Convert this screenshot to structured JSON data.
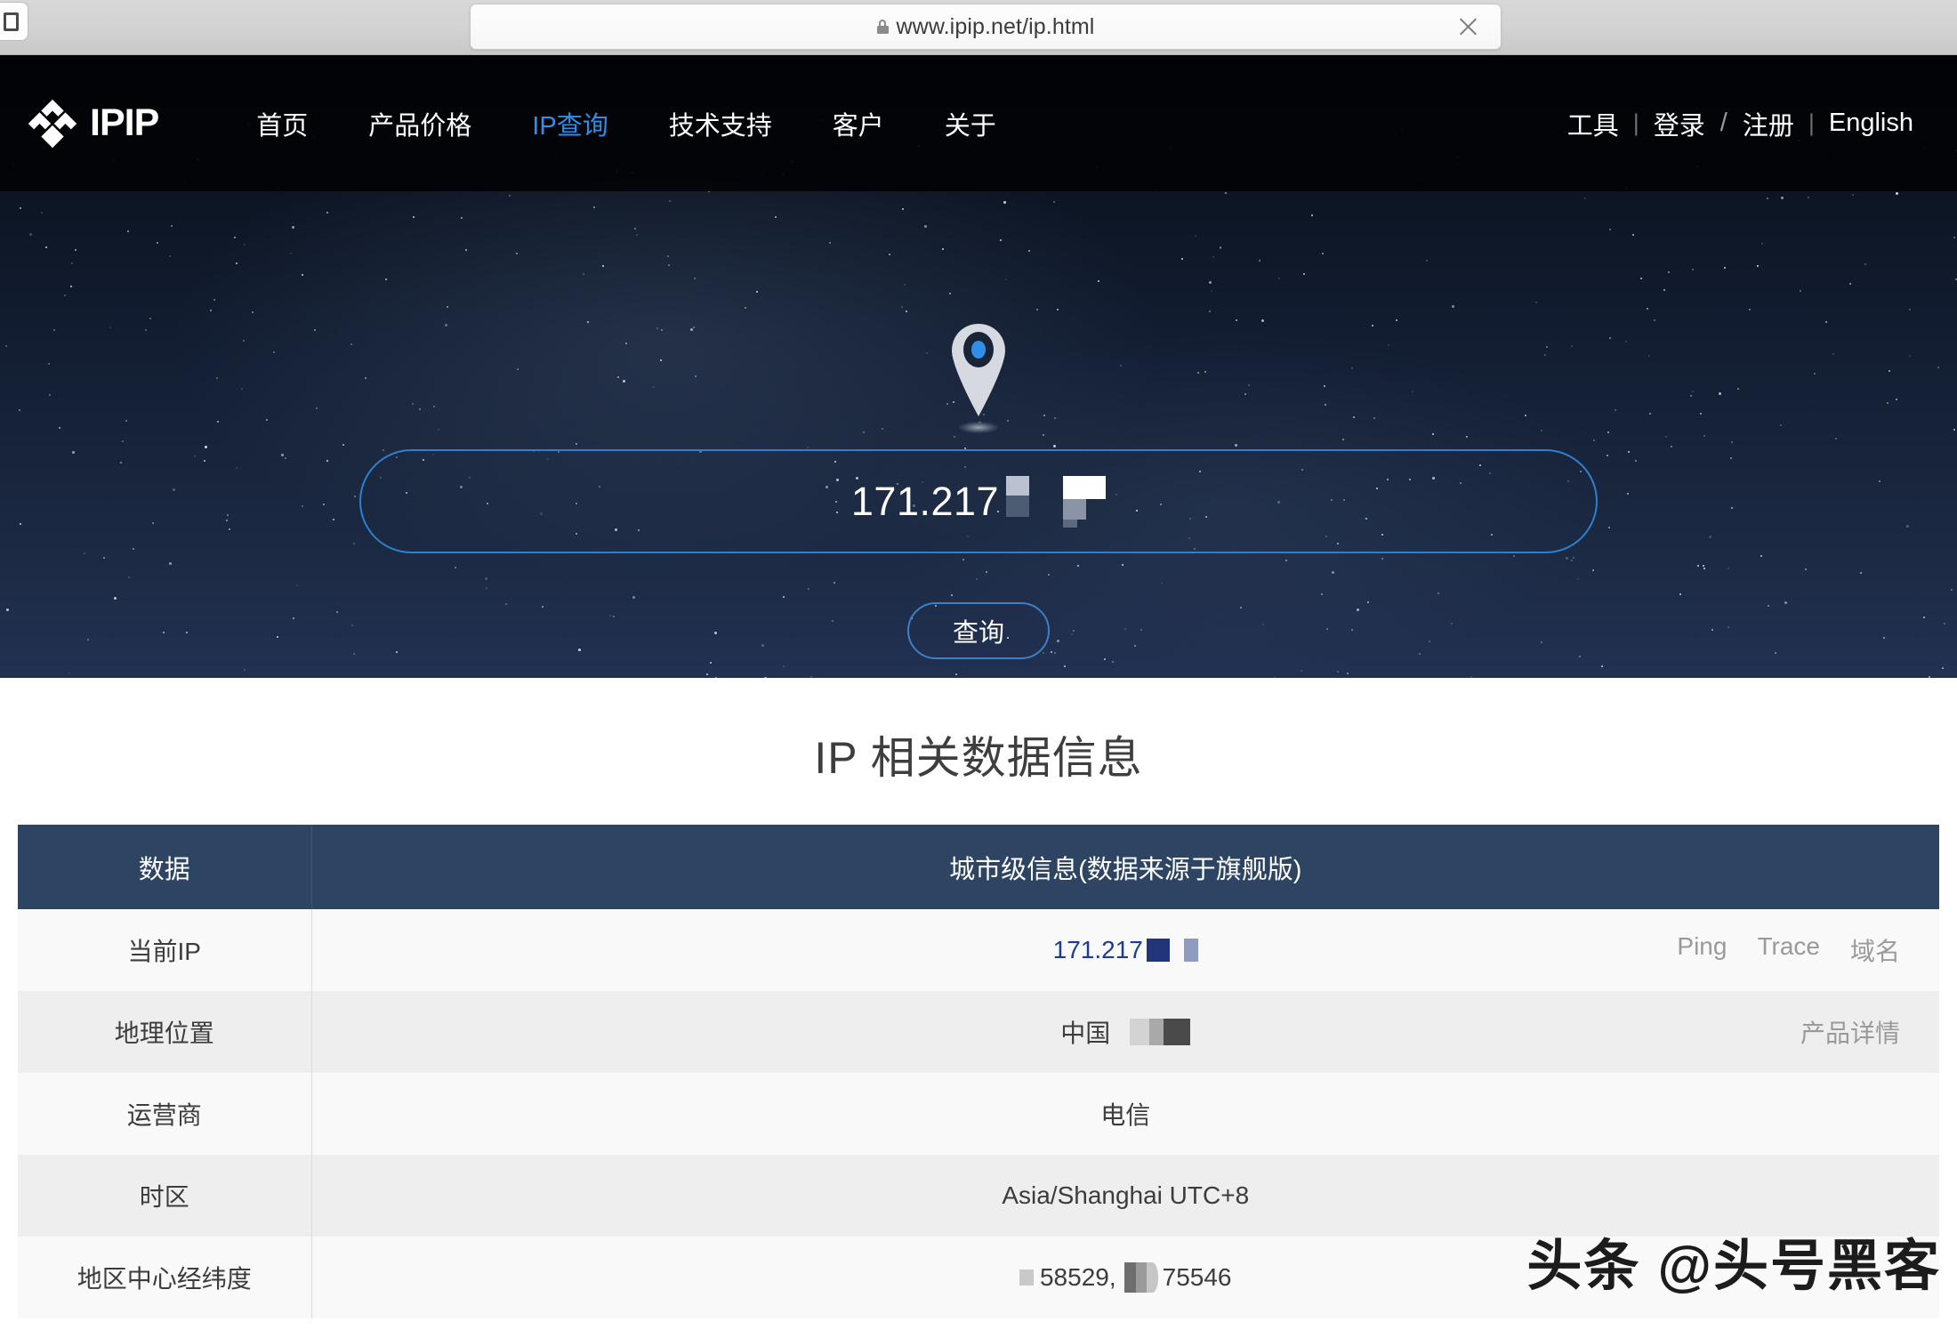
{
  "browser": {
    "url": "www.ipip.net/ip.html",
    "lock_icon": "lock-icon",
    "close_icon": "close-icon"
  },
  "nav": {
    "logo_text": "IPIP",
    "logo_icon": "ipip-logo-icon",
    "items": [
      {
        "label": "首页",
        "active": false
      },
      {
        "label": "产品价格",
        "active": false
      },
      {
        "label": "IP查询",
        "active": true
      },
      {
        "label": "技术支持",
        "active": false
      },
      {
        "label": "客户",
        "active": false
      },
      {
        "label": "关于",
        "active": false
      }
    ],
    "right": {
      "tools": "工具",
      "login": "登录",
      "slash": "/",
      "register": "注册",
      "english": "English",
      "separator": "|"
    },
    "active_color": "#2f8fe8"
  },
  "hero": {
    "pin_icon": "map-pin-icon",
    "search_value": "171.217",
    "search_redacted": true,
    "query_button": "查询"
  },
  "main": {
    "title": "IP 相关数据信息",
    "table": {
      "headers": [
        "数据",
        "城市级信息(数据来源于旗舰版)"
      ],
      "rows": [
        {
          "label": "当前IP",
          "value": "171.217",
          "redacted": true,
          "actions": [
            "Ping",
            "Trace",
            "域名"
          ]
        },
        {
          "label": "地理位置",
          "value": "中国",
          "redacted": true,
          "actions": [
            "产品详情"
          ]
        },
        {
          "label": "运营商",
          "value": "电信",
          "redacted": false,
          "actions": []
        },
        {
          "label": "时区",
          "value": "Asia/Shanghai UTC+8",
          "redacted": false,
          "actions": []
        },
        {
          "label": "地区中心经纬度",
          "value_lat": "58529,",
          "value_lng": "75546",
          "redacted": true,
          "actions": []
        }
      ]
    },
    "header_bg": "#2e4463",
    "link_color": "#1f3a93"
  },
  "watermark": {
    "text": "头条 @头号黑客"
  }
}
